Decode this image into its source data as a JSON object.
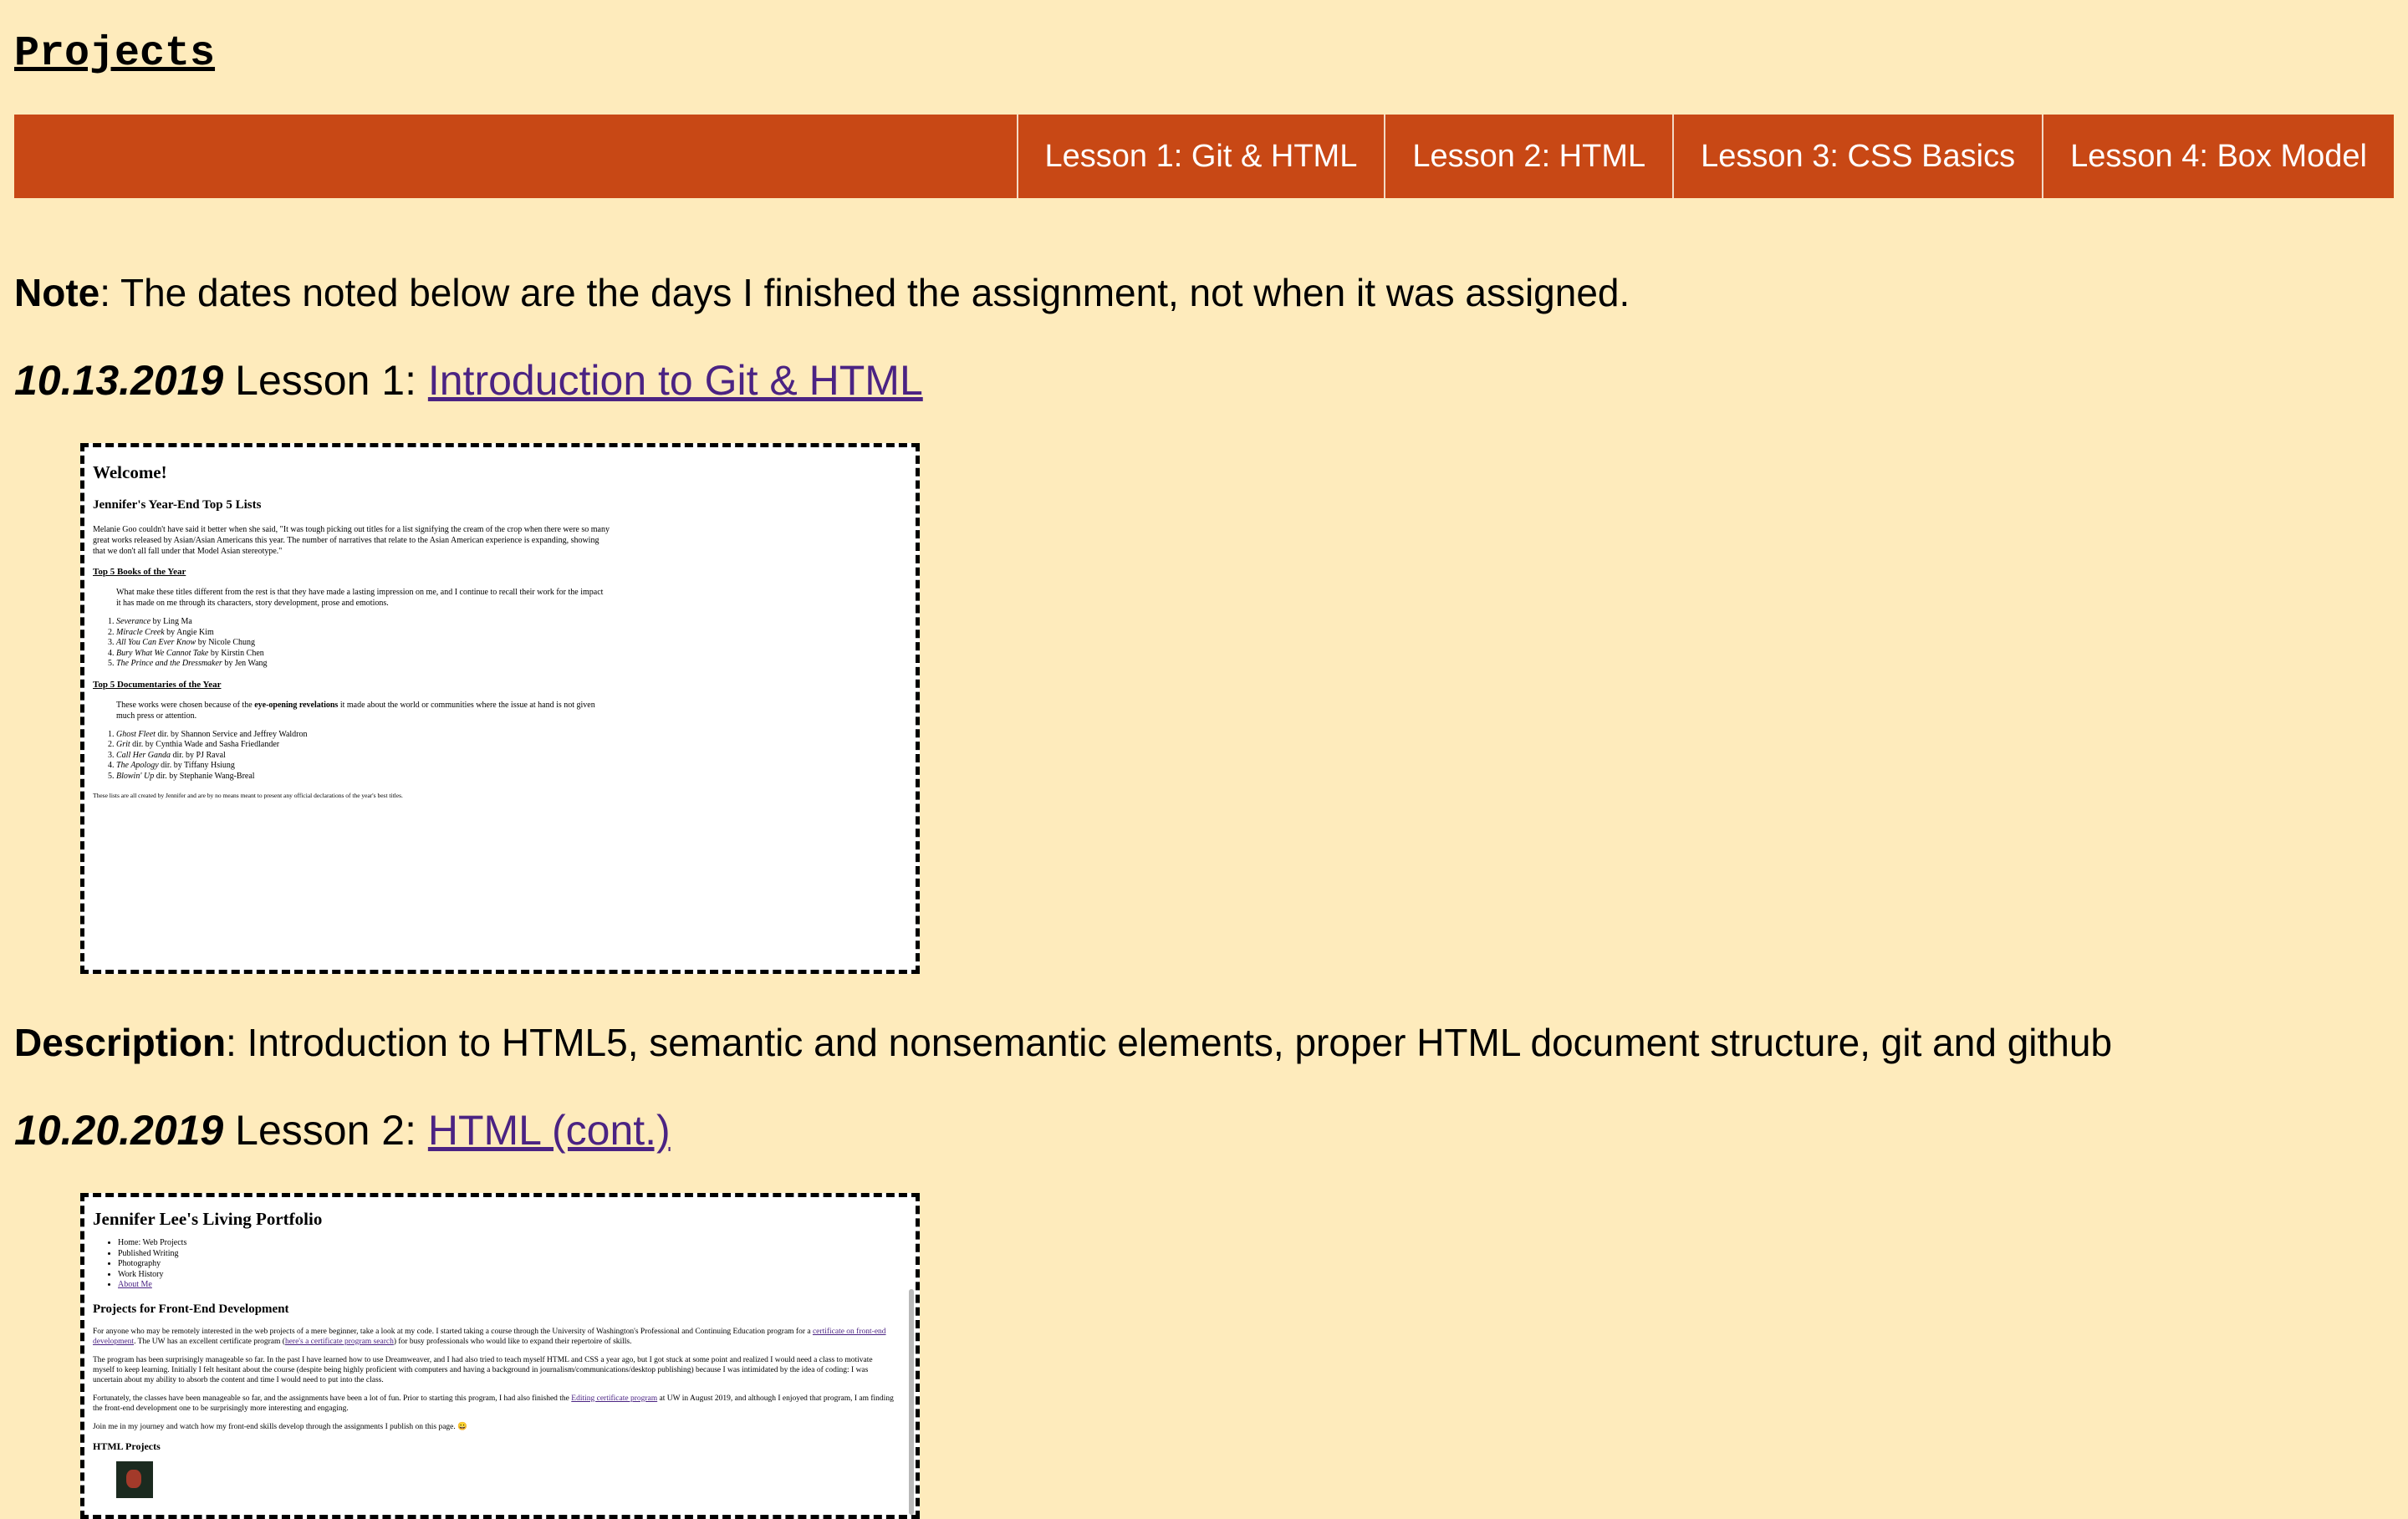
{
  "site": {
    "title": "Projects"
  },
  "nav": {
    "items": [
      {
        "label": "Lesson 1: Git & HTML"
      },
      {
        "label": "Lesson 2: HTML"
      },
      {
        "label": "Lesson 3: CSS Basics"
      },
      {
        "label": "Lesson 4: Box Model"
      }
    ]
  },
  "note": {
    "label": "Note",
    "text": ": The dates noted below are the days I finished the assignment, not when it was assigned."
  },
  "lessons": [
    {
      "date": "10.13.2019",
      "prefix": " Lesson 1: ",
      "link": "Introduction to Git & HTML",
      "description_label": "Description",
      "description": ": Introduction to HTML5, semantic and nonsemantic elements, proper HTML document structure, git and github"
    },
    {
      "date": "10.20.2019",
      "prefix": " Lesson 2: ",
      "link": "HTML (cont.)"
    }
  ],
  "preview1": {
    "heading": "Welcome!",
    "subheading": "Jennifer's Year-End Top 5 Lists",
    "intro": "Melanie Goo couldn't have said it better when she said, \"It was tough picking out titles for a list signifying the cream of the crop when there were so many great works released by Asian/Asian Americans this year. The number of narratives that relate to the Asian American experience is expanding, showing that we don't all fall under that Model Asian stereotype.\"",
    "books": {
      "title": "Top 5 Books of the Year",
      "blurb": "What make these titles different from the rest is that they have made a lasting impression on me, and I continue to recall their work for the impact it has made on me through its characters, story development, prose and emotions.",
      "items": [
        {
          "title": "Severance",
          "by": " by Ling Ma"
        },
        {
          "title": "Miracle Creek",
          "by": " by Angie Kim"
        },
        {
          "title": "All You Can Ever Know",
          "by": " by Nicole Chung"
        },
        {
          "title": "Bury What We Cannot Take",
          "by": " by Kirstin Chen"
        },
        {
          "title": "The Prince and the Dressmaker",
          "by": " by Jen Wang"
        }
      ]
    },
    "docs": {
      "title": "Top 5 Documentaries of the Year",
      "blurb_pre": "These works were chosen because of the ",
      "blurb_bold": "eye-opening revelations",
      "blurb_post": " it made about the world or communities where the issue at hand is not given much press or attention.",
      "items": [
        {
          "title": "Ghost Fleet",
          "by": " dir. by Shannon Service and Jeffrey Waldron"
        },
        {
          "title": "Grit",
          "by": " dir. by Cynthia Wade and Sasha Friedlander"
        },
        {
          "title": "Call Her Ganda",
          "by": " dir. by PJ Raval"
        },
        {
          "title": "The Apology",
          "by": " dir. by Tiffany Hsiung"
        },
        {
          "title": "Blowin' Up",
          "by": " dir. by Stephanie Wang-Breal"
        }
      ]
    },
    "footnote": "These lists are all created by Jennifer and are by no means meant to present any official declarations of the year's best titles."
  },
  "preview2": {
    "title": "Jennifer Lee's Living Portfolio",
    "nav": [
      "Home: Web Projects",
      "Published Writing",
      "Photography",
      "Work History",
      "About Me"
    ],
    "heading": "Projects for Front-End Development",
    "p1_a": "For anyone who may be remotely interested in the web projects of a mere beginner, take a look at my code. I started taking a course through the University of Washington's Professional and Continuing Education program for a ",
    "p1_link1": "certificate on front-end development",
    "p1_b": ". The UW has an excellent certificate program (",
    "p1_link2": "here's a certificate program search",
    "p1_c": ") for busy professionals who would like to expand their repertoire of skills.",
    "p2": "The program has been surprisingly manageable so far. In the past I have learned how to use Dreamweaver, and I had also tried to teach myself HTML and CSS a year ago, but I got stuck at some point and realized I would need a class to motivate myself to keep learning. Initially I felt hesitant about the course (despite being highly proficient with computers and having a background in journalism/communications/desktop publishing) because I was intimidated by the idea of coding: I was uncertain about my ability to absorb the content and time I would need to put into the class.",
    "p3_a": "Fortunately, the classes have been manageable so far, and the assignments have been a lot of fun. Prior to starting this program, I had also finished the ",
    "p3_link": "Editing certificate program",
    "p3_b": " at UW in August 2019, and although I enjoyed that program, I am finding the front-end development one to be surprisingly more interesting and engaging.",
    "p4": "Join me in my journey and watch how my front-end skills develop through the assignments I publish on this page. 😀",
    "subheading": "HTML Projects"
  }
}
